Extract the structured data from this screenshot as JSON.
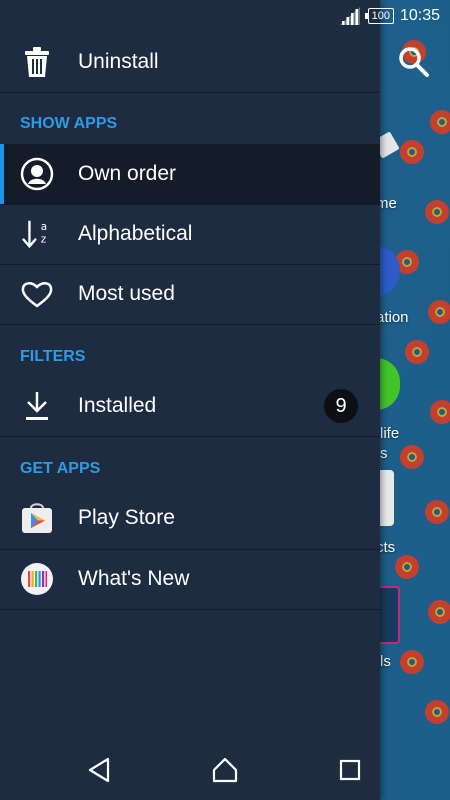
{
  "status_bar": {
    "battery": "100",
    "time": "10:35"
  },
  "drawer": {
    "uninstall_label": "Uninstall",
    "sections": {
      "show_apps": "SHOW APPS",
      "filters": "FILTERS",
      "get_apps": "GET APPS"
    },
    "show_apps_items": [
      {
        "label": "Own order",
        "icon": "person-circle-icon",
        "selected": true
      },
      {
        "label": "Alphabetical",
        "icon": "sort-az-icon",
        "selected": false
      },
      {
        "label": "Most used",
        "icon": "heart-icon",
        "selected": false
      }
    ],
    "filter_items": [
      {
        "label": "Installed",
        "icon": "download-icon",
        "badge": "9"
      }
    ],
    "get_apps_items": [
      {
        "label": "Play Store",
        "icon": "play-store-icon"
      },
      {
        "label": "What's New",
        "icon": "whats-new-icon"
      }
    ]
  },
  "background": {
    "partial_labels": [
      "me",
      "ation",
      "life",
      "s",
      "cts",
      "ls"
    ]
  },
  "colors": {
    "drawer_bg": "#1e2c42",
    "section_header": "#2d9be6",
    "selected_bg": "#141c29",
    "accent": "#1a97e7",
    "background": "#1d5e8a"
  }
}
